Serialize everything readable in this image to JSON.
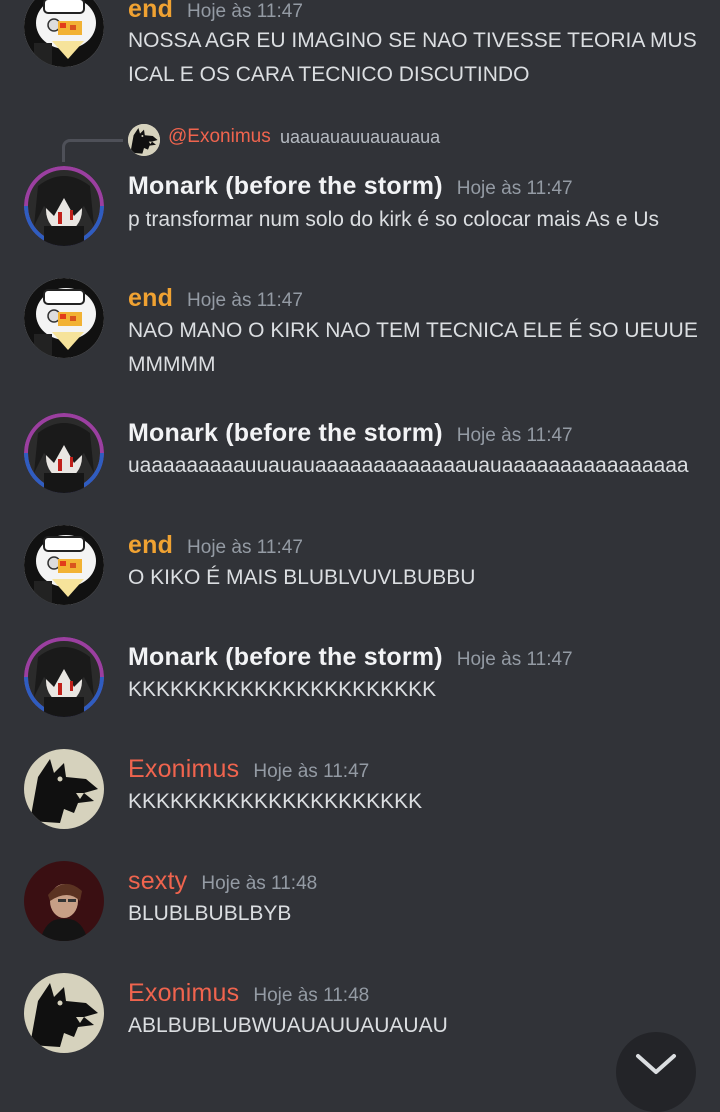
{
  "colors": {
    "background": "#313338",
    "end": "#f0a232",
    "monark": "#f2f3f5",
    "exonimus": "#f0644e",
    "sexty": "#f0644e",
    "timestamp": "#949ba4",
    "text": "#dbdee1"
  },
  "reply": {
    "name": "@Exonimus",
    "text": "uaauauauuauauaua"
  },
  "messages": [
    {
      "author": "end",
      "time": "Hoje às 11:47",
      "text": "NOSSA AGR EU IMAGINO SE NAO TIVESSE TEORIA MUSICAL E OS CARA TECNICO DISCUTINDO",
      "avatar": "duck-avatar"
    },
    {
      "author": "Monark (before the storm)",
      "time": "Hoje às 11:47",
      "text": "p transformar num solo do kirk é so colocar mais As e Us",
      "avatar": "anime-avatar"
    },
    {
      "author": "end",
      "time": "Hoje às 11:47",
      "text": "NAO MANO O KIRK NAO TEM TECNICA ELE É SO UEUUEMMMMM",
      "avatar": "duck-avatar"
    },
    {
      "author": "Monark (before the storm)",
      "time": "Hoje às 11:47",
      "text": "uaaaaaaaaauuauauaaaaaaaaaaaaauauaaaaaaaaaaaaaaaa",
      "avatar": "anime-avatar"
    },
    {
      "author": "end",
      "time": "Hoje às 11:47",
      "text": "O KIKO É MAIS BLUBLVUVLBUBBU",
      "avatar": "duck-avatar"
    },
    {
      "author": "Monark (before the storm)",
      "time": "Hoje às 11:47",
      "text": "KKKKKKKKKKKKKKKKKKKKKK",
      "avatar": "anime-avatar"
    },
    {
      "author": "Exonimus",
      "time": "Hoje às 11:47",
      "text": "KKKKKKKKKKKKKKKKKKKKK",
      "avatar": "wolf-avatar"
    },
    {
      "author": "sexty",
      "time": "Hoje às 11:48",
      "text": "BLUBLBUBLBYB",
      "avatar": "portrait-avatar"
    },
    {
      "author": "Exonimus",
      "time": "Hoje às 11:48",
      "text": "ABLBUBLUBWUAUAUUAUAUAU",
      "avatar": "wolf-avatar"
    }
  ],
  "scroll_button_icon": "chevron-down-icon"
}
